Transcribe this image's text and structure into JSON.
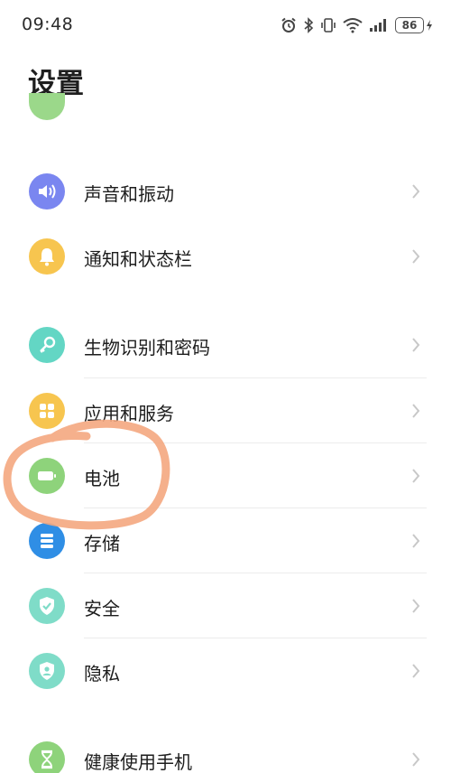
{
  "status_bar": {
    "time": "09:48",
    "battery_level": "86",
    "icons": [
      "alarm-icon",
      "bluetooth-icon",
      "vibrate-icon",
      "wifi-icon",
      "signal-icon",
      "battery-icon"
    ]
  },
  "page": {
    "title": "设置"
  },
  "settings": {
    "items": [
      {
        "label": "声音和振动",
        "icon": "speaker-icon",
        "color": "#7a86f0"
      },
      {
        "label": "通知和状态栏",
        "icon": "bell-icon",
        "color": "#f7c54f"
      },
      {
        "label": "生物识别和密码",
        "icon": "key-icon",
        "color": "#63d6c4"
      },
      {
        "label": "应用和服务",
        "icon": "apps-grid-icon",
        "color": "#f7c54f"
      },
      {
        "label": "电池",
        "icon": "battery-icon",
        "color": "#8ed37b"
      },
      {
        "label": "存储",
        "icon": "storage-icon",
        "color": "#2f8ee5"
      },
      {
        "label": "安全",
        "icon": "shield-check-icon",
        "color": "#7fdcc8"
      },
      {
        "label": "隐私",
        "icon": "privacy-shield-icon",
        "color": "#7fdcc8"
      },
      {
        "label": "健康使用手机",
        "icon": "hourglass-icon",
        "color": "#8ed37b"
      }
    ]
  },
  "annotation": {
    "color": "#f4a77f",
    "target": "电池"
  }
}
